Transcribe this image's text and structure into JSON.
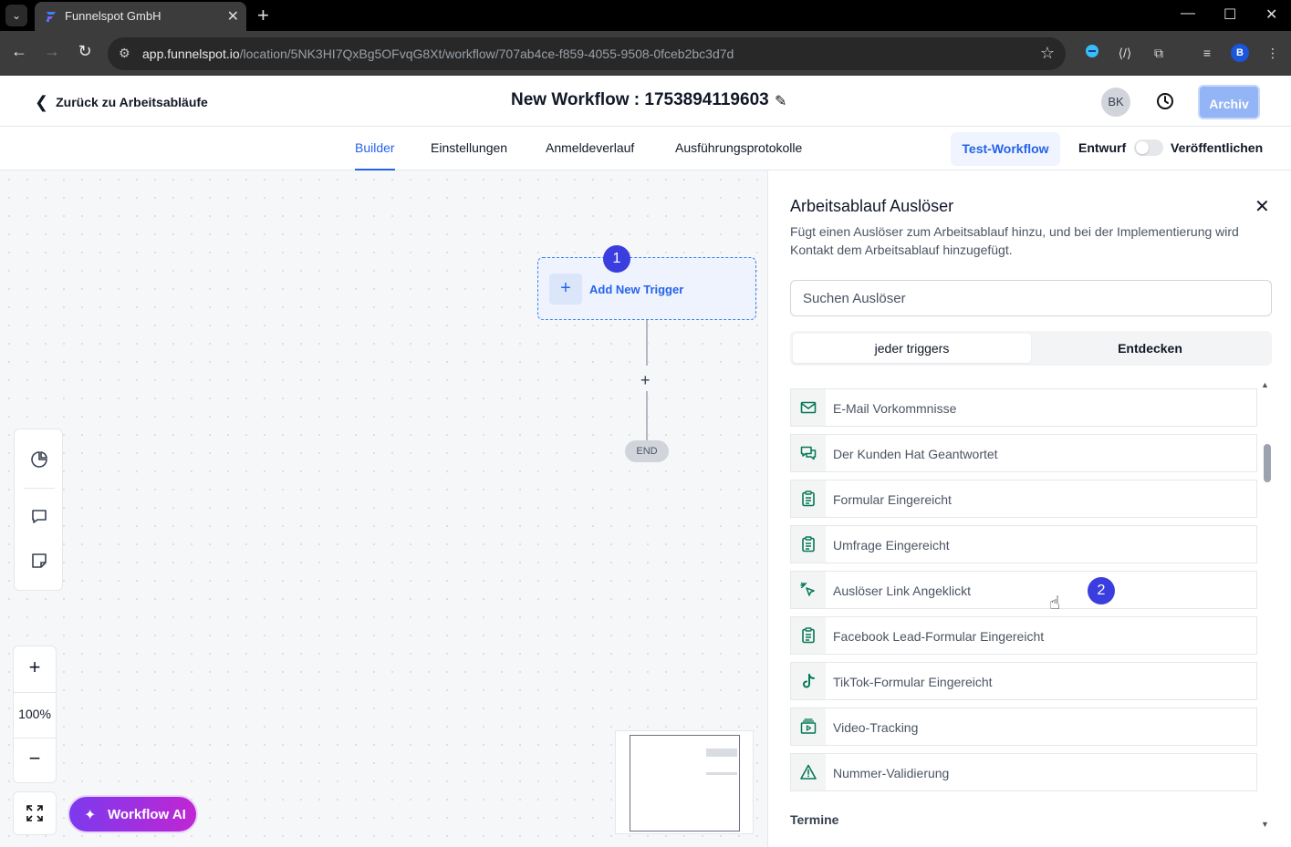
{
  "browser": {
    "tab_title": "Funnelspot GmbH",
    "url_host": "app.funnelspot.io",
    "url_path": "/location/5NK3HI7QxBg5OFvqG8Xt/workflow/707ab4ce-f859-4055-9508-0fceb2bc3d7d",
    "profile_initial": "B"
  },
  "header": {
    "back_label": "Zurück zu Arbeitsabläufe",
    "workflow_title": "New Workflow : 1753894119603",
    "avatar_initials": "BK",
    "archive_label": "Archiv"
  },
  "tabs": [
    {
      "label": "Builder",
      "active": true
    },
    {
      "label": "Einstellungen"
    },
    {
      "label": "Anmeldeverlauf"
    },
    {
      "label": "Ausführungsprotokolle"
    }
  ],
  "actions": {
    "test_label": "Test-Workflow",
    "draft_label": "Entwurf",
    "publish_label": "Veröffentlichen",
    "publish_on": false
  },
  "canvas": {
    "add_trigger_label": "Add New Trigger",
    "end_label": "END",
    "zoom_level": "100%",
    "ai_button_label": "Workflow AI",
    "step_badges": [
      "1",
      "2"
    ]
  },
  "panel": {
    "title": "Arbeitsablauf Auslöser",
    "description": "Fügt einen Auslöser zum Arbeitsablauf hinzu, und bei der Implementierung wird Kontakt dem Arbeitsablauf hinzugefügt.",
    "search_placeholder": "Suchen Auslöser",
    "segments": [
      {
        "label": "jeder triggers",
        "active": true
      },
      {
        "label": "Entdecken"
      }
    ],
    "items": [
      {
        "label": "E-Mail Vorkommnisse",
        "icon": "mail-icon"
      },
      {
        "label": "Der Kunden Hat Geantwortet",
        "icon": "chat-bubbles-icon"
      },
      {
        "label": "Formular Eingereicht",
        "icon": "clipboard-icon"
      },
      {
        "label": "Umfrage Eingereicht",
        "icon": "clipboard-icon"
      },
      {
        "label": "Auslöser Link Angeklickt",
        "icon": "cursor-click-icon"
      },
      {
        "label": "Facebook Lead-Formular Eingereicht",
        "icon": "clipboard-icon"
      },
      {
        "label": "TikTok-Formular Eingereicht",
        "icon": "tiktok-icon"
      },
      {
        "label": "Video-Tracking",
        "icon": "video-icon"
      },
      {
        "label": "Nummer-Validierung",
        "icon": "warning-icon"
      }
    ],
    "next_section": "Termine"
  },
  "colors": {
    "accent": "#2563eb",
    "icon_green": "#047857",
    "badge": "#3b3ede"
  }
}
